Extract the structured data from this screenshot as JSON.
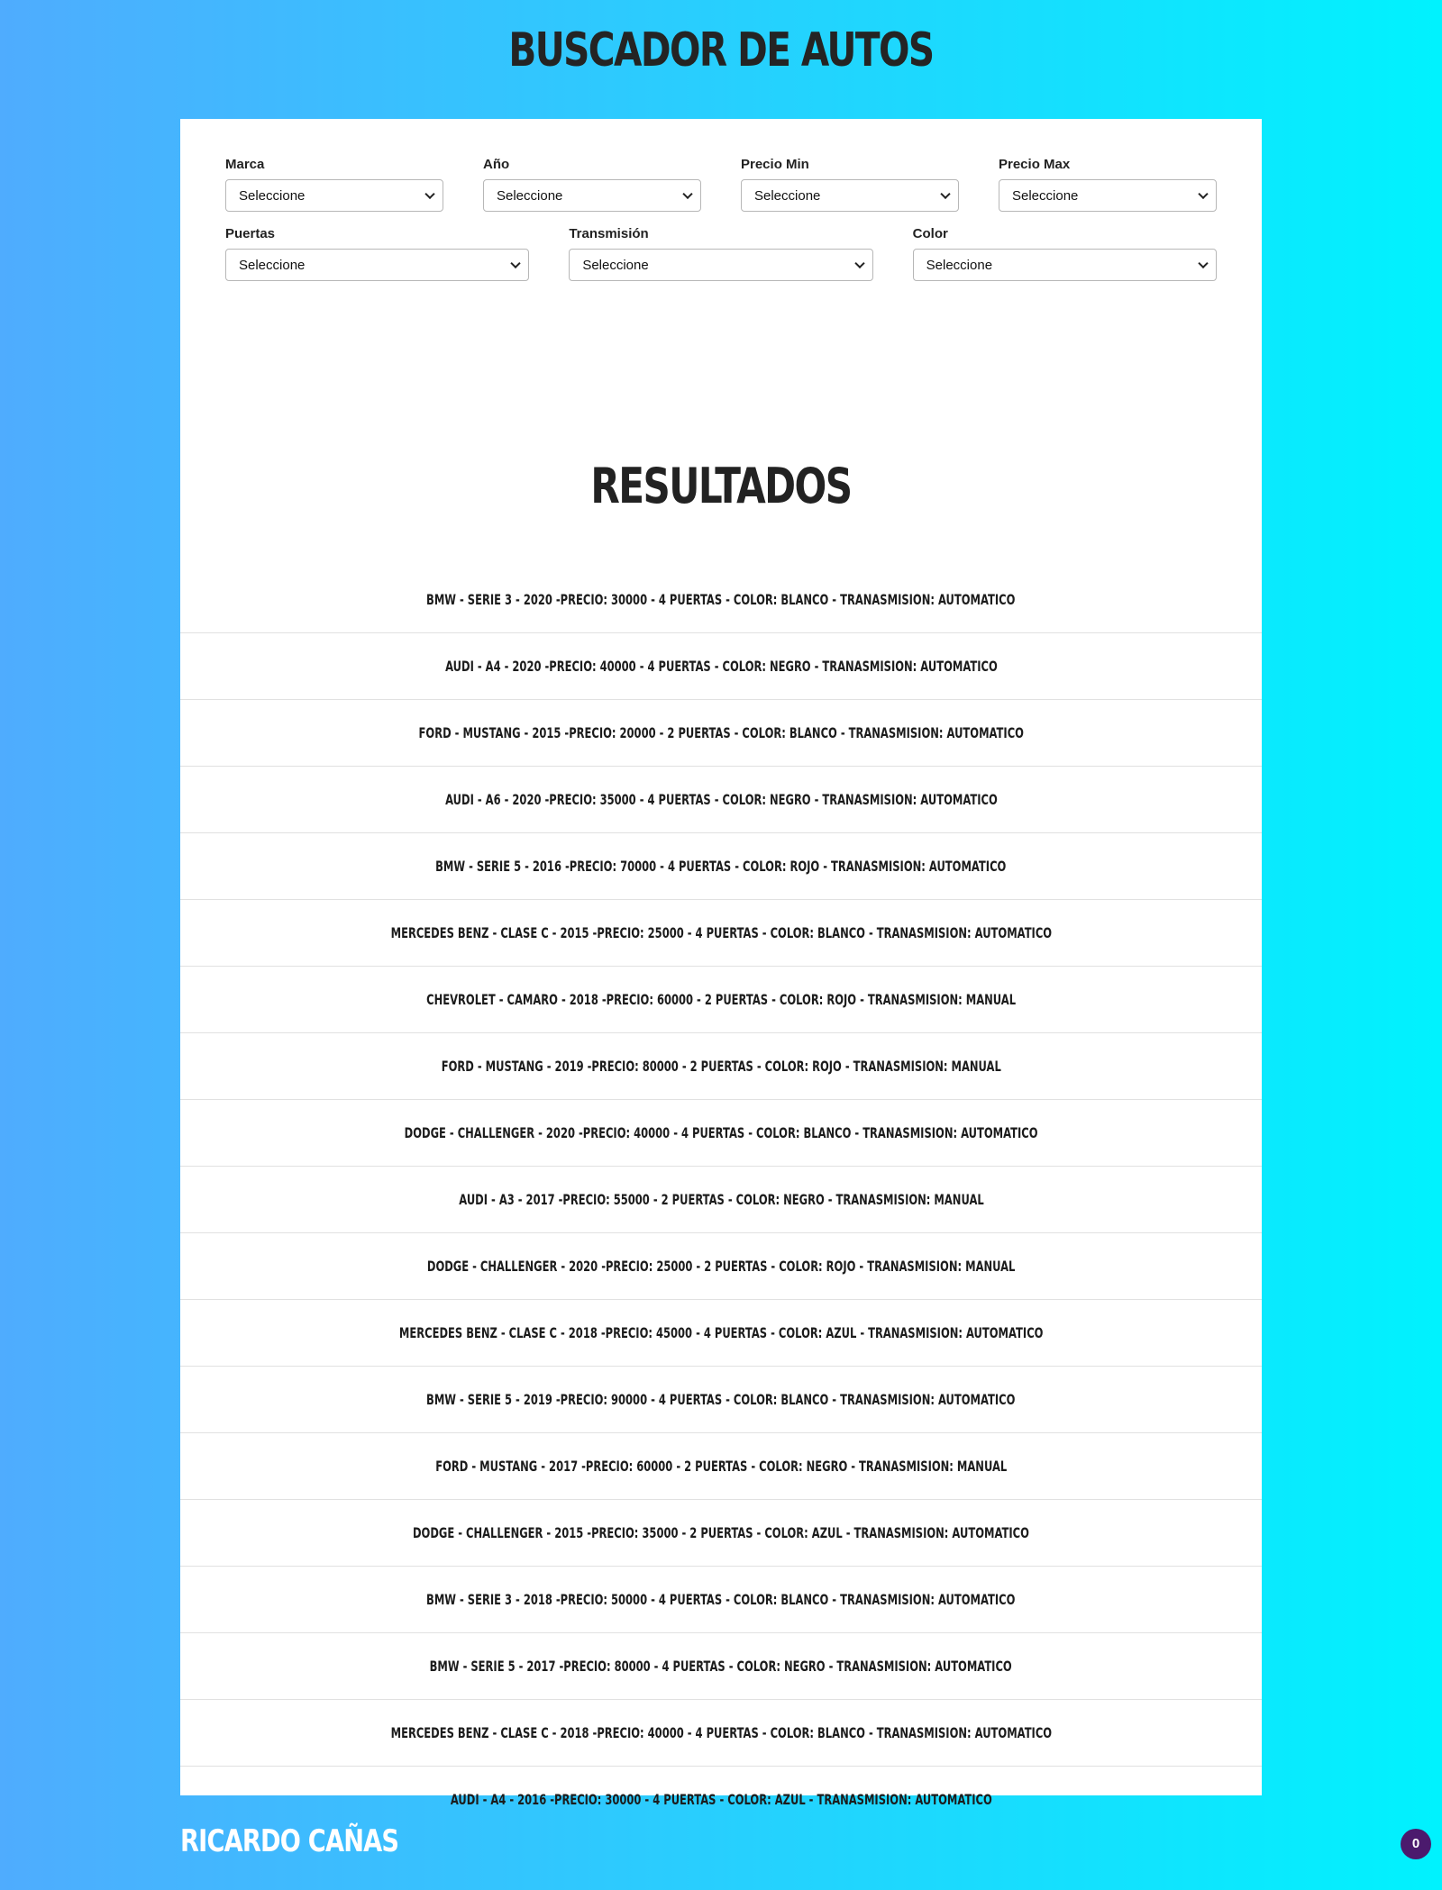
{
  "header": {
    "title": "BUSCADOR DE AUTOS"
  },
  "filters": {
    "marca": {
      "label": "Marca",
      "value": "Seleccione"
    },
    "anio": {
      "label": "Año",
      "value": "Seleccione"
    },
    "precio_min": {
      "label": "Precio Min",
      "value": "Seleccione"
    },
    "precio_max": {
      "label": "Precio Max",
      "value": "Seleccione"
    },
    "puertas": {
      "label": "Puertas",
      "value": "Seleccione"
    },
    "transmision": {
      "label": "Transmisión",
      "value": "Seleccione"
    },
    "color": {
      "label": "Color",
      "value": "Seleccione"
    }
  },
  "results": {
    "title": "RESULTADOS",
    "items": [
      "BMW - Serie 3 - 2020 -Precio: 30000 - 4 Puertas - Color: Blanco - Tranasmision: automatico",
      "Audi - A4 - 2020 -Precio: 40000 - 4 Puertas - Color: Negro - Tranasmision: automatico",
      "Ford - Mustang - 2015 -Precio: 20000 - 2 Puertas - Color: Blanco - Tranasmision: automatico",
      "Audi - A6 - 2020 -Precio: 35000 - 4 Puertas - Color: Negro - Tranasmision: automatico",
      "BMW - Serie 5 - 2016 -Precio: 70000 - 4 Puertas - Color: Rojo - Tranasmision: automatico",
      "Mercedes Benz - Clase C - 2015 -Precio: 25000 - 4 Puertas - Color: Blanco - Tranasmision: automatico",
      "Chevrolet - Camaro - 2018 -Precio: 60000 - 2 Puertas - Color: Rojo - Tranasmision: manual",
      "Ford - Mustang - 2019 -Precio: 80000 - 2 Puertas - Color: Rojo - Tranasmision: manual",
      "Dodge - Challenger - 2020 -Precio: 40000 - 4 Puertas - Color: Blanco - Tranasmision: automatico",
      "Audi - A3 - 2017 -Precio: 55000 - 2 Puertas - Color: Negro - Tranasmision: manual",
      "Dodge - Challenger - 2020 -Precio: 25000 - 2 Puertas - Color: Rojo - Tranasmision: manual",
      "Mercedes Benz - Clase C - 2018 -Precio: 45000 - 4 Puertas - Color: Azul - Tranasmision: automatico",
      "BMW - Serie 5 - 2019 -Precio: 90000 - 4 Puertas - Color: Blanco - Tranasmision: automatico",
      "Ford - Mustang - 2017 -Precio: 60000 - 2 Puertas - Color: Negro - Tranasmision: manual",
      "Dodge - Challenger - 2015 -Precio: 35000 - 2 Puertas - Color: Azul - Tranasmision: automatico",
      "BMW - Serie 3 - 2018 -Precio: 50000 - 4 Puertas - Color: Blanco - Tranasmision: automatico",
      "BMW - Serie 5 - 2017 -Precio: 80000 - 4 Puertas - Color: Negro - Tranasmision: automatico",
      "Mercedes Benz - Clase C - 2018 -Precio: 40000 - 4 Puertas - Color: Blanco - Tranasmision: automatico",
      "Audi - A4 - 2016 -Precio: 30000 - 4 Puertas - Color: Azul - Tranasmision: automatico"
    ]
  },
  "footer": {
    "author": "RICARDO CAÑAS"
  },
  "notification_badge": {
    "count": "0"
  },
  "colors": {
    "gradient_start": "#4facfe",
    "gradient_end": "#00f2fe",
    "badge": "#4b1a6d"
  }
}
